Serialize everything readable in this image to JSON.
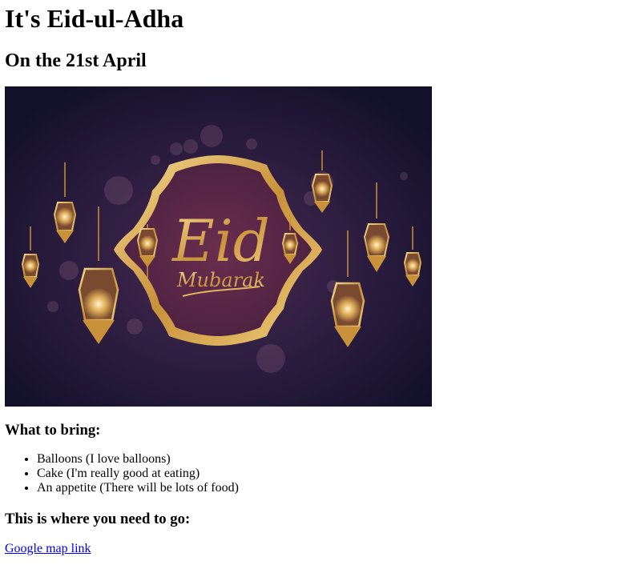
{
  "page": {
    "title": "It's Eid-ul-Adha",
    "subtitle": "On the 21st April"
  },
  "banner": {
    "main_text": "Eid",
    "script_text": "Mubarak",
    "colors": {
      "background_dark": "#14122a",
      "background_purple": "#3b2348",
      "frame_fill": "#5a2a48",
      "gold": "#d9a84a",
      "gold_light": "#f3d58a"
    }
  },
  "bring": {
    "heading": "What to bring:",
    "items": [
      "Balloons (I love balloons)",
      "Cake (I'm really good at eating)",
      "An appetite (There will be lots of food)"
    ]
  },
  "location": {
    "heading": "This is where you need to go:",
    "link_text": "Google map link"
  }
}
